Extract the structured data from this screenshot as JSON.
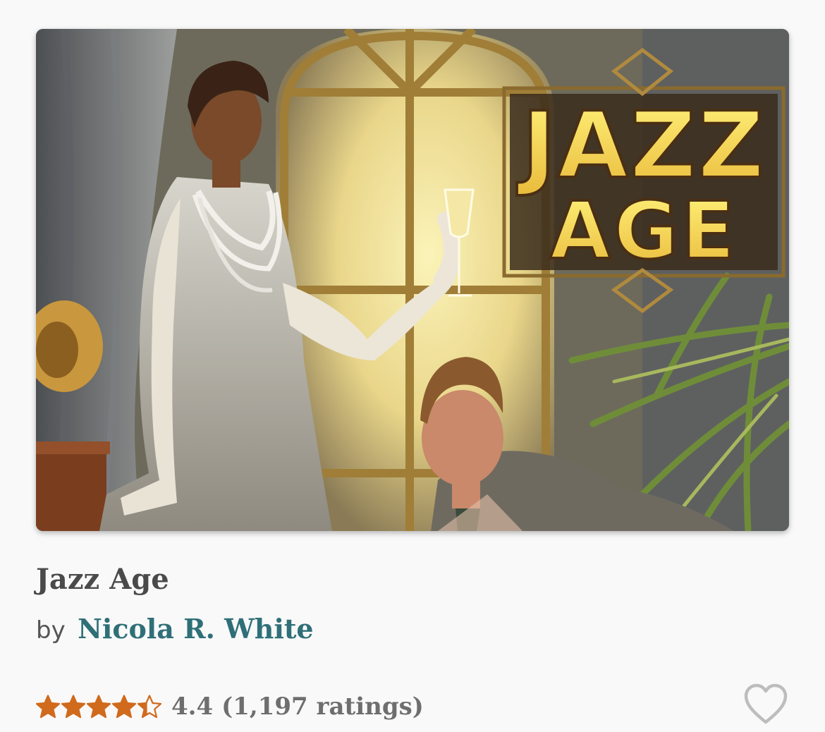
{
  "book": {
    "title": "Jazz Age",
    "cover_logo_line1": "JAZZ",
    "cover_logo_line2": "AGE",
    "by_prefix": "by",
    "author": "Nicola R. White",
    "rating_value": "4.4",
    "rating_count": "(1,197 ratings)",
    "stars": 4.4,
    "stars_max": 5
  },
  "colors": {
    "star": "#d06a1c",
    "author_link": "#2f6f78",
    "title_text": "#4a4a4a",
    "muted_text": "#6e6e6e",
    "heart_outline": "#bdbdbd"
  },
  "icons": {
    "favorite": "heart-outline-icon",
    "star": "star-icon"
  }
}
